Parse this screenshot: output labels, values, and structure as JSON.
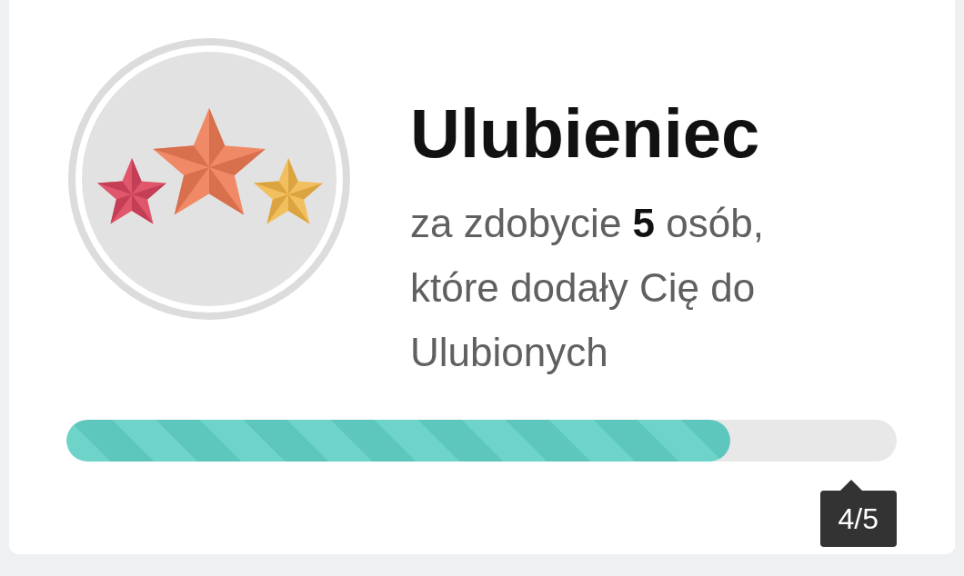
{
  "badge": {
    "title": "Ulubieniec",
    "description": "za zdobycie **5** osób, które dodały Cię do Ulubionych"
  },
  "progress": {
    "level": 0.8,
    "label": "4/5"
  }
}
